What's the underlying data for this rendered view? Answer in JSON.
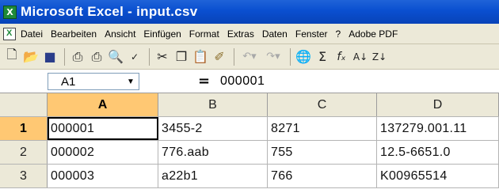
{
  "window": {
    "title": "Microsoft Excel - input.csv"
  },
  "menu": [
    "Datei",
    "Bearbeiten",
    "Ansicht",
    "Einfügen",
    "Format",
    "Extras",
    "Daten",
    "Fenster",
    "?",
    "Adobe PDF"
  ],
  "toolbar": {
    "icons": [
      "new-icon",
      "open-icon",
      "save-icon",
      "print-icon",
      "print-preview-icon",
      "page-preview-icon",
      "spell-check-icon",
      "cut-icon",
      "copy-icon",
      "paste-icon",
      "format-painter-icon",
      "undo-icon",
      "redo-icon",
      "hyperlink-icon",
      "autosum-icon",
      "function-icon",
      "sort-ascending-icon",
      "sort-descending-icon"
    ]
  },
  "formula_bar": {
    "name_box": "A1",
    "equals": "=",
    "value": "000001"
  },
  "columns": [
    "A",
    "B",
    "C",
    "D"
  ],
  "rows": [
    {
      "num": "1",
      "cells": [
        "000001",
        "3455-2",
        "8271",
        "137279.001.11"
      ]
    },
    {
      "num": "2",
      "cells": [
        "000002",
        "776.aab",
        "755",
        "12.5-6651.0"
      ]
    },
    {
      "num": "3",
      "cells": [
        "000003",
        "a22b1",
        "766",
        "K00965514"
      ]
    }
  ],
  "selection": {
    "cell": "A1",
    "column": "A",
    "row": "1"
  }
}
